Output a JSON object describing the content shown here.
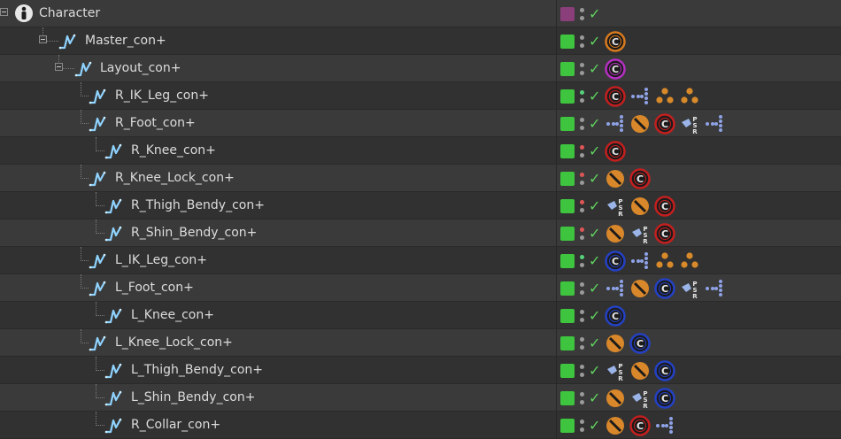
{
  "object_manager": {
    "rows": [
      {
        "name": "Character",
        "depth": 0,
        "icon": "character-icon",
        "expander": true,
        "color": "#8a3e7a",
        "top_dot": "#9a9a9a",
        "check": "✓",
        "tags": []
      },
      {
        "name": "Master_con+",
        "depth": 1,
        "icon": "spline-icon",
        "expander": true,
        "color": "#3ec43e",
        "top_dot": "#9a9a9a",
        "check": "✓",
        "tags": [
          "constraint-orange"
        ]
      },
      {
        "name": "Layout_con+",
        "depth": 2,
        "icon": "spline-icon",
        "expander": true,
        "color": "#3ec43e",
        "top_dot": "#9a9a9a",
        "check": "✓",
        "tags": [
          "constraint-purple"
        ]
      },
      {
        "name": "R_IK_Leg_con+",
        "depth": 3,
        "icon": "spline-icon",
        "expander": false,
        "color": "#3ec43e",
        "top_dot": "#56d27a",
        "check": "✓",
        "tags": [
          "constraint-red",
          "ik",
          "dots3",
          "dots3"
        ]
      },
      {
        "name": "R_Foot_con+",
        "depth": 3,
        "icon": "spline-icon",
        "expander": false,
        "color": "#3ec43e",
        "top_dot": "#9a9a9a",
        "check": "✓",
        "tags": [
          "ik",
          "protection",
          "constraint-red",
          "pose",
          "ik"
        ]
      },
      {
        "name": "R_Knee_con+",
        "depth": 4,
        "icon": "spline-icon",
        "expander": false,
        "color": "#3ec43e",
        "top_dot": "#e05656",
        "check": "✓",
        "tags": [
          "constraint-red"
        ]
      },
      {
        "name": "R_Knee_Lock_con+",
        "depth": 3,
        "icon": "spline-icon",
        "expander": false,
        "color": "#3ec43e",
        "top_dot": "#e05656",
        "check": "✓",
        "tags": [
          "protection",
          "constraint-red"
        ]
      },
      {
        "name": "R_Thigh_Bendy_con+",
        "depth": 4,
        "icon": "spline-icon",
        "expander": false,
        "color": "#3ec43e",
        "top_dot": "#e05656",
        "check": "✓",
        "tags": [
          "pose",
          "protection",
          "constraint-red"
        ]
      },
      {
        "name": "R_Shin_Bendy_con+",
        "depth": 4,
        "icon": "spline-icon",
        "expander": false,
        "color": "#3ec43e",
        "top_dot": "#e05656",
        "check": "✓",
        "tags": [
          "protection",
          "pose",
          "constraint-red"
        ]
      },
      {
        "name": "L_IK_Leg_con+",
        "depth": 3,
        "icon": "spline-icon",
        "expander": false,
        "color": "#3ec43e",
        "top_dot": "#56d27a",
        "check": "✓",
        "tags": [
          "constraint-blue",
          "ik",
          "dots3",
          "dots3"
        ]
      },
      {
        "name": "L_Foot_con+",
        "depth": 3,
        "icon": "spline-icon",
        "expander": false,
        "color": "#3ec43e",
        "top_dot": "#9a9a9a",
        "check": "✓",
        "tags": [
          "ik",
          "protection",
          "constraint-blue",
          "pose",
          "ik"
        ]
      },
      {
        "name": "L_Knee_con+",
        "depth": 4,
        "icon": "spline-icon",
        "expander": false,
        "color": "#3ec43e",
        "top_dot": "#9a9a9a",
        "check": "✓",
        "tags": [
          "constraint-blue"
        ]
      },
      {
        "name": "L_Knee_Lock_con+",
        "depth": 3,
        "icon": "spline-icon",
        "expander": false,
        "color": "#3ec43e",
        "top_dot": "#9a9a9a",
        "check": "✓",
        "tags": [
          "protection",
          "constraint-blue"
        ]
      },
      {
        "name": "L_Thigh_Bendy_con+",
        "depth": 4,
        "icon": "spline-icon",
        "expander": false,
        "color": "#3ec43e",
        "top_dot": "#9a9a9a",
        "check": "✓",
        "tags": [
          "pose",
          "protection",
          "constraint-blue"
        ]
      },
      {
        "name": "L_Shin_Bendy_con+",
        "depth": 4,
        "icon": "spline-icon",
        "expander": false,
        "color": "#3ec43e",
        "top_dot": "#9a9a9a",
        "check": "✓",
        "tags": [
          "protection",
          "pose",
          "constraint-blue"
        ]
      },
      {
        "name": "R_Collar_con+",
        "depth": 4,
        "icon": "spline-icon",
        "expander": false,
        "color": "#3ec43e",
        "top_dot": "#9a9a9a",
        "check": "✓",
        "tags": [
          "protection",
          "constraint-red",
          "ik"
        ]
      }
    ]
  },
  "colors": {
    "constraint_orange": "#d87a1e",
    "constraint_purple": "#b52fc2",
    "constraint_red": "#c41f1f",
    "constraint_blue": "#2441c4",
    "protection": "#d8872a",
    "ik": "#8ea2e6",
    "dots3": "#d88a2a",
    "pose": "#9ab4e8"
  }
}
